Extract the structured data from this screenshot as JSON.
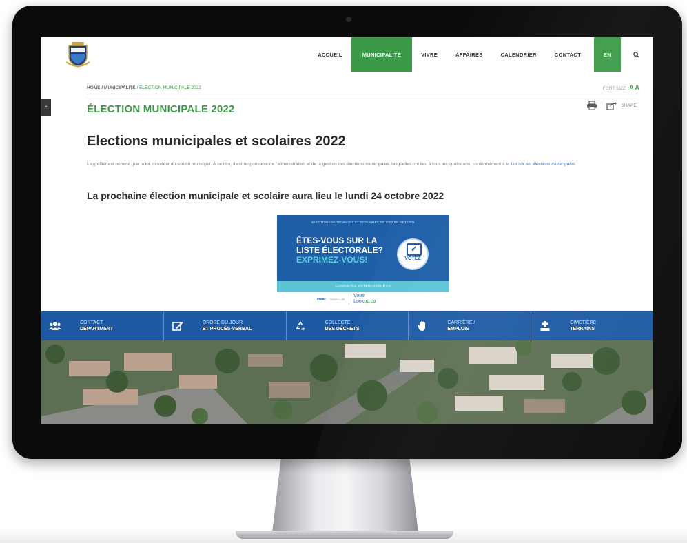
{
  "nav": {
    "items": [
      "ACCUEIL",
      "MUNICIPALITÉ",
      "VIVRE",
      "AFFAIRES",
      "CALENDRIER",
      "CONTACT"
    ],
    "active_index": 1,
    "lang": "EN",
    "search_icon": "search-icon",
    "accent": "#3a9a48"
  },
  "breadcrumb": {
    "home": "HOME",
    "sep1": " / ",
    "parent": "MUNICIPALITÉ",
    "sep2": " / ",
    "current": "ÉLECTION MUNICIPALE 2022"
  },
  "font_size": {
    "label": "FONT SIZE",
    "minus": "-",
    "aa": "A A",
    "plus": "+"
  },
  "page_title": "ÉLECTION MUNICIPALE 2022",
  "share": {
    "label": "SHARE",
    "print_icon": "print-icon",
    "share_icon": "share-icon"
  },
  "content": {
    "heading": "Elections municipales et scolaires 2022",
    "para_main": "Le greffier est nommé, par la loi, directeur du scrutin municipal. À ce titre, il est responsable de l'administration et de la gestion des élections municipales, lesquelles ont lieu à tous les quatre ans, conformément à la ",
    "para_link": "Loi sur les élections municipales",
    "para_end": ".",
    "subheading": "La prochaine élection municipale et scolaire aura lieu le lundi 24 octobre 2022"
  },
  "banner": {
    "top_text": "ÉLECTIONS MUNICIPALES ET SCOLAIRES DE 2022 EN ONTARIO",
    "line1": "ÊTES-VOUS SUR LA",
    "line2": "LISTE ÉLECTORALE?",
    "line3": "EXPRIMEZ-VOUS!",
    "vote": "VOTEZ",
    "bottom_text": "CONSULTEZ VOTERLOOKUP.CA",
    "brand_color": "#1e5fa8",
    "accent_color": "#5cc4d4"
  },
  "logos": {
    "mpac": "mpac",
    "partner": "Voters List",
    "lookup_1": "Voter",
    "lookup_2": "Look",
    "lookup_3": "up.ca"
  },
  "quick_links": [
    {
      "icon": "people-icon",
      "line1": "CONTACT",
      "line2": "DÉPARTMENT"
    },
    {
      "icon": "edit-icon",
      "line1": "ORDRE DU JOUR",
      "line2": "ET PROCÈS-VERBAL"
    },
    {
      "icon": "recycle-icon",
      "line1": "COLLECTE",
      "line2": "DES DÉCHETS"
    },
    {
      "icon": "hand-icon",
      "line1": "CARRIÈRE /",
      "line2": "EMPLOIS"
    },
    {
      "icon": "cemetery-icon",
      "line1": "CIMETIÈRE",
      "line2": "TERRAINS"
    }
  ],
  "side_tab": "+",
  "hero_photo": "aerial-neighbourhood-photo"
}
